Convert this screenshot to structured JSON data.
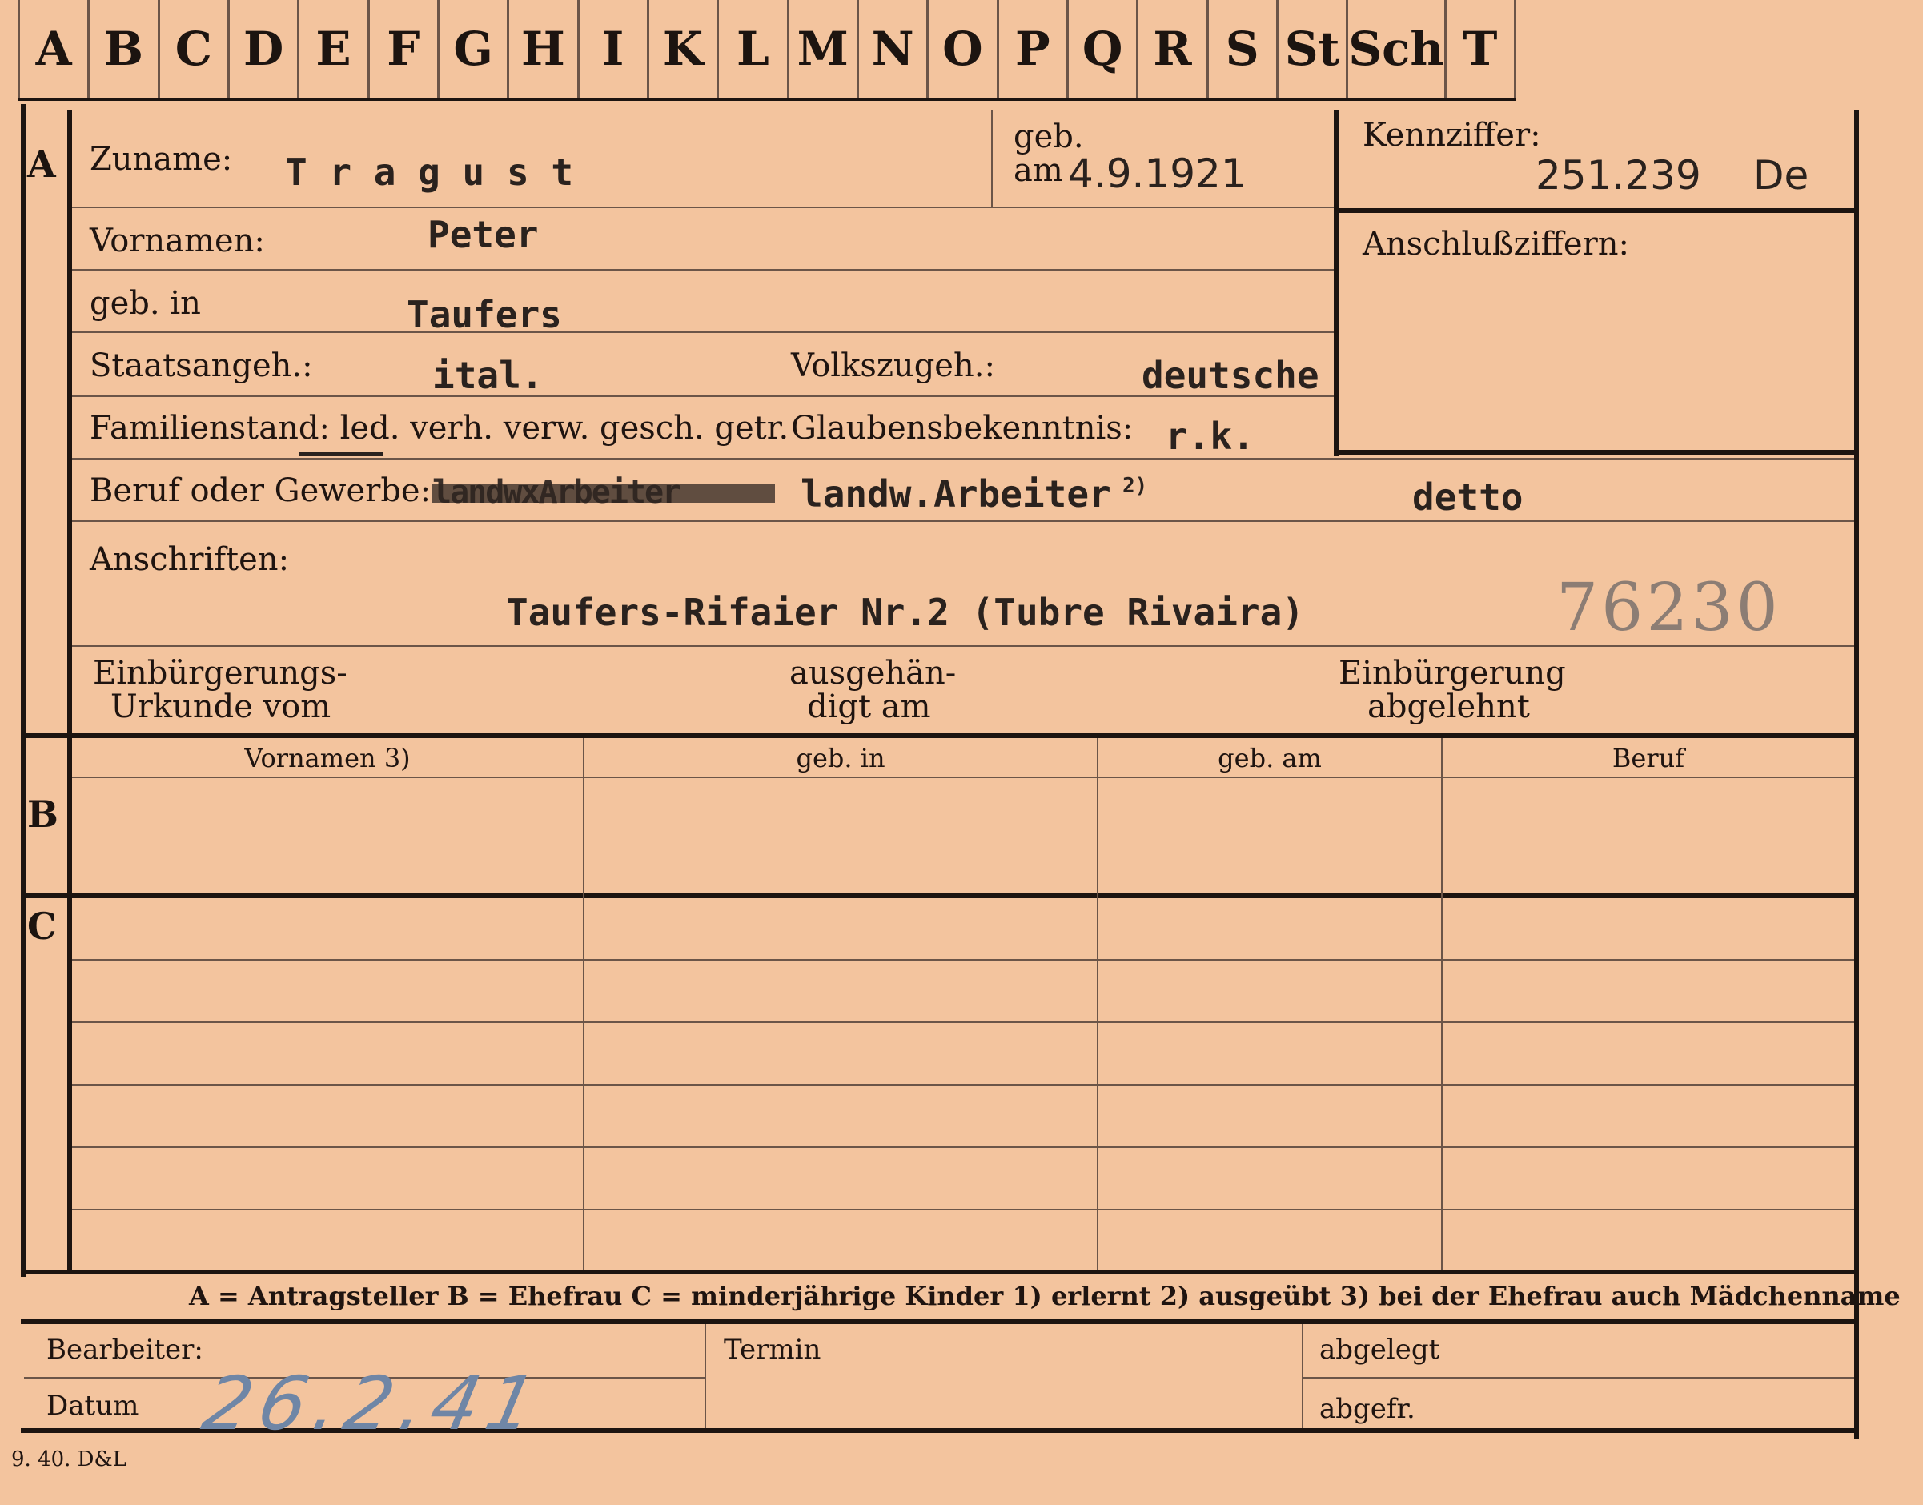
{
  "tabs": [
    "A",
    "B",
    "C",
    "D",
    "E",
    "F",
    "G",
    "H",
    "I",
    "K",
    "L",
    "M",
    "N",
    "O",
    "P",
    "Q",
    "R",
    "S",
    "St",
    "Sch",
    "T"
  ],
  "section_a": {
    "letter": "A",
    "zuname_label": "Zuname:",
    "zuname_value": "T r a g u s t",
    "geb_label": "geb.",
    "am_label": "am",
    "geb_date": "4.9.1921",
    "kennziffer_label": "Kennziffer:",
    "kennziffer_value": "251.239",
    "kennziffer_suffix": "De",
    "anschluss_label": "Anschlußziffern:",
    "vornamen_label": "Vornamen:",
    "vornamen_value": "Peter",
    "gebin_label": "geb. in",
    "gebin_value": "Taufers",
    "staat_label": "Staatsangeh.:",
    "staat_value": "ital.",
    "volk_label": "Volkszugeh.:",
    "volk_value": "deutsche",
    "familien_label": "Familienstand: led. verh. verw. gesch. getr.",
    "glauben_label": "Glaubensbekenntnis:",
    "glauben_value": "r.k.",
    "beruf_label": "Beruf oder Gewerbe:",
    "beruf_struck": "landwxArbeiter",
    "beruf_value": "landw.Arbeiter",
    "beruf_note": "2)",
    "beruf_second": "detto",
    "anschriften_label": "Anschriften:",
    "anschriften_value": "Taufers-Rifaier Nr.2 (Tubre Rivaira)",
    "stamp_number": "76230",
    "einb_label_1": "Einbürgerungs-",
    "einb_label_2": "Urkunde vom",
    "ausgeh_label_1": "ausgehän-",
    "ausgeh_label_2": "digt am",
    "einb_abg_label_1": "Einbürgerung",
    "einb_abg_label_2": "abgelehnt"
  },
  "section_b": {
    "letter": "B",
    "columns": [
      "Vornamen 3)",
      "geb. in",
      "geb. am",
      "Beruf"
    ]
  },
  "section_c": {
    "letter": "C"
  },
  "legend": "A = Antragsteller   B = Ehefrau   C = minderjährige Kinder   1) erlernt   2) ausgeübt   3) bei der Ehefrau auch Mädchenname",
  "footer": {
    "bearbeiter_label": "Bearbeiter:",
    "datum_label": "Datum",
    "datum_value": "26.2.41",
    "termin_label": "Termin",
    "abgelegt_label": "abgelegt",
    "abgefr_label": "abgefr."
  },
  "print_mark": "9. 40. D&L"
}
